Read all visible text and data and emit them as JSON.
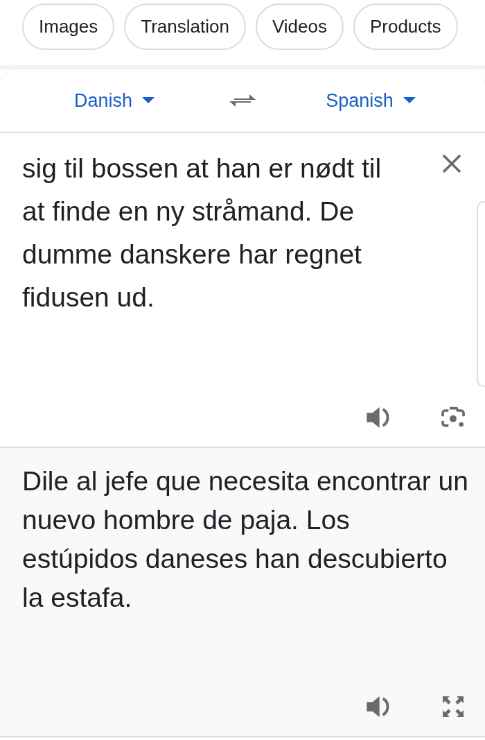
{
  "chips": [
    {
      "label": "Images"
    },
    {
      "label": "Translation"
    },
    {
      "label": "Videos"
    },
    {
      "label": "Products"
    }
  ],
  "languages": {
    "source": "Danish",
    "target": "Spanish"
  },
  "source_text": "sig til bossen at han er nødt til at finde en ny stråmand. De dumme danskere har regnet fidusen ud.",
  "translation": "Dile al jefe que necesita encontrar un nuevo hombre de paja. Los estúpidos daneses han descubierto la estafa."
}
